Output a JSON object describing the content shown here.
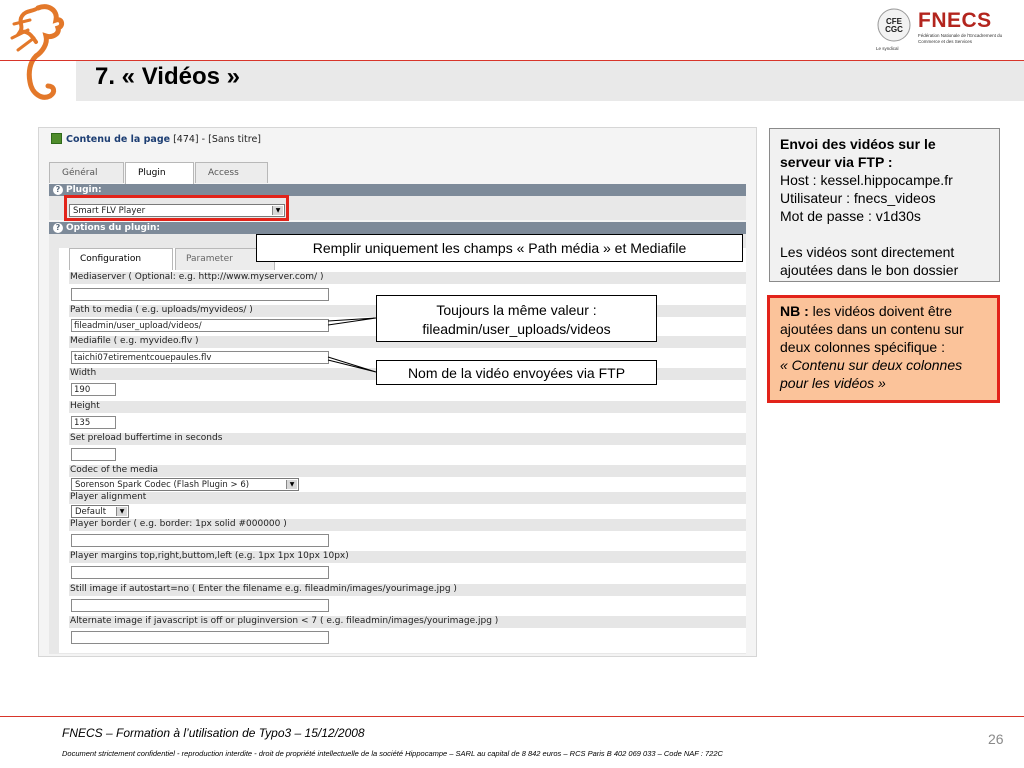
{
  "slide": {
    "title": "7. « Vidéos »",
    "page_number": "26"
  },
  "logo": {
    "badge_text": "CFE CGC",
    "name": "FNECS",
    "subtitle": "Fédération Nationale de l'Encadrement du Commerce et des Services",
    "tagline": "Le syndical"
  },
  "typo3": {
    "header_label": "Contenu de la page",
    "header_rest": "[474] - [Sans titre]",
    "tabs": [
      "Général",
      "Plugin",
      "Access"
    ],
    "plugin_section": "Plugin:",
    "plugin_value": "Smart FLV Player",
    "options_section": "Options du plugin:",
    "subtabs": [
      "Configuration",
      "Parameter"
    ],
    "fields": {
      "mediaserver_label": "Mediaserver ( Optional: e.g. http://www.myserver.com/ )",
      "mediaserver_value": "",
      "path_label": "Path to media ( e.g. uploads/myvideos/ )",
      "path_value": "fileadmin/user_upload/videos/",
      "mediafile_label": "Mediafile ( e.g. myvideo.flv )",
      "mediafile_value": "taichi07etirementcouepaules.flv",
      "width_label": "Width",
      "width_value": "190",
      "height_label": "Height",
      "height_value": "135",
      "preload_label": "Set preload buffertime in seconds",
      "preload_value": "",
      "codec_label": "Codec of the media",
      "codec_value": "Sorenson Spark Codec (Flash Plugin > 6)",
      "alignment_label": "Player alignment",
      "alignment_value": "Default",
      "border_label": "Player border ( e.g. border: 1px solid #000000 )",
      "border_value": "",
      "margins_label": "Player margins top,right,buttom,left (e.g. 1px 1px 10px 10px)",
      "margins_value": "",
      "still_label": "Still image if autostart=no ( Enter the filename e.g. fileadmin/images/yourimage.jpg )",
      "still_value": "",
      "alternate_label": "Alternate image if javascript is off or pluginversion < 7 ( e.g. fileadmin/images/yourimage.jpg )",
      "alternate_value": ""
    }
  },
  "callouts": {
    "fill_fields": "Remplir uniquement les champs « Path média » et  Mediafile",
    "same_value_line1": "Toujours la même valeur :",
    "same_value_line2": "fileadmin/user_uploads/videos",
    "ftp_name": "Nom de la vidéo envoyées via FTP"
  },
  "info_box": {
    "heading": "Envoi des vidéos sur le serveur via FTP :",
    "host": "Host : kessel.hippocampe.fr",
    "user": "Utilisateur : fnecs_videos",
    "password": "Mot de passe : v1d30s",
    "note": "Les vidéos sont directement ajoutées dans le bon dossier"
  },
  "nb_box": {
    "label": "NB :",
    "text": " les vidéos doivent être ajoutées dans un contenu sur deux colonnes spécifique :",
    "italic": "« Contenu sur deux colonnes pour les vidéos »"
  },
  "footer": {
    "line1": "FNECS – Formation à l’utilisation de Typo3 – 15/12/2008",
    "line2": "Document strictement confidentiel - reproduction interdite - droit de propriété intellectuelle de la société Hippocampe – SARL au capital de 8 842 euros – RCS Paris B 402 069 033 – Code NAF : 722C"
  },
  "colors": {
    "accent_red": "#e2231a",
    "brand_red": "#b3251e",
    "nb_fill": "#fbc39a",
    "section_header": "#7d8a99"
  }
}
